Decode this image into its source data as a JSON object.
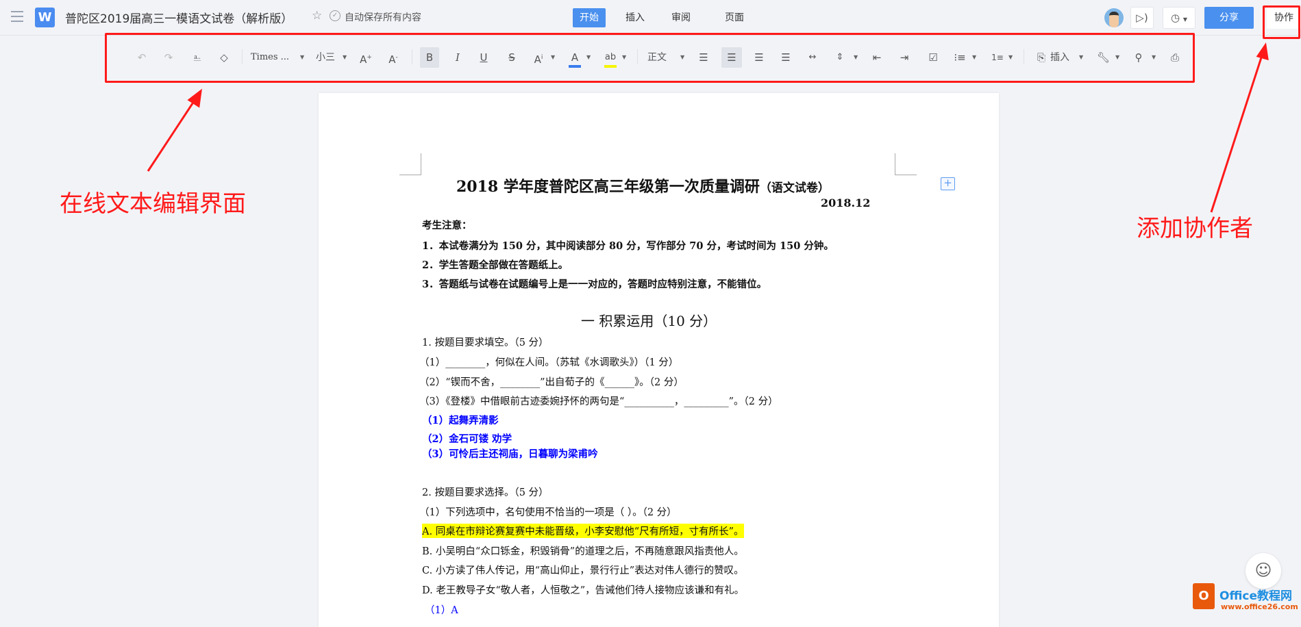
{
  "header": {
    "doc_title": "普陀区2019届高三一模语文试卷（解析版）",
    "autosave": "自动保存所有内容",
    "logo": "W",
    "tabs": [
      {
        "label": "开始"
      },
      {
        "label": "插入"
      },
      {
        "label": "审阅"
      },
      {
        "label": "页面"
      }
    ],
    "share": "分享",
    "collab": "协作"
  },
  "toolbar": {
    "font": "Times ...",
    "size": "小三",
    "style": "正文",
    "insert": "插入",
    "font_color": "#3b7ded",
    "highlight_color": "#f5f500"
  },
  "document": {
    "title": "2018 学年度普陀区高三年级第一次质量调研",
    "title_suffix": "（语文试卷）",
    "date": "2018.12",
    "notice_head": "考生注意：",
    "notices": [
      "1．本试卷满分为 150 分，其中阅读部分 80 分，写作部分 70 分，考试时间为 150 分钟。",
      "2．学生答题全部做在答题纸上。",
      "3．答题纸与试卷在试题编号上是一一对应的，答题时应特别注意，不能错位。"
    ],
    "section": "一  积累运用（10 分）",
    "q1": "1.    按题目要求填空。（5 分）",
    "q1_items": [
      "（1）________，何似在人间。（苏轼《水调歌头》）（1 分）",
      "（2）“锲而不舍，________”出自荀子的《______》。（2 分）",
      "（3）《登楼》中借眼前古迹委婉抒怀的两句是“__________，_________”。（2 分）"
    ],
    "q1_answers": [
      "（1）起舞弄清影",
      "（2）金石可镂    劝学",
      "（3）可怜后主还祠庙，日暮聊为梁甫吟"
    ],
    "q2": "2.    按题目要求选择。（5 分）",
    "q2_stem": "（1）下列选项中，名句使用不恰当的一项是（     ）。（2 分）",
    "q2_options": [
      "A. 同桌在市辩论赛复赛中未能晋级，小李安慰他“尺有所短，寸有所长”。",
      "B. 小吴明白“众口铄金，积毁销骨”的道理之后，不再随意跟风指责他人。",
      "C. 小方读了伟人传记，用“高山仰止，景行行止”表达对伟人德行的赞叹。",
      "D. 老王教导子女“敬人者，人恒敬之”，告诫他们待人接物应该谦和有礼。"
    ],
    "q2_answer": "（1）A"
  },
  "annotations": {
    "left": "在线文本编辑界面",
    "right": "添加协作者",
    "color": "#ff1a1a"
  },
  "watermark": {
    "brand": "Office教程网",
    "url": "www.office26.com"
  }
}
